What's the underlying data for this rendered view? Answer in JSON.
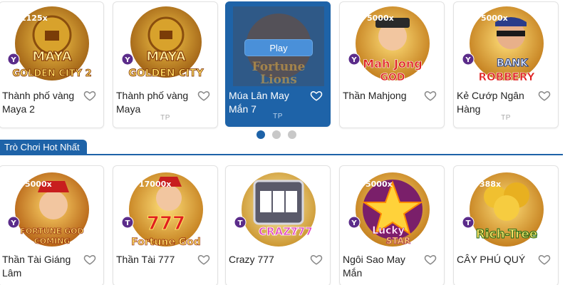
{
  "carousel_top": {
    "cards": [
      {
        "title": "Thành phố vàng Maya 2",
        "provider": "",
        "art_text": [
          "MAYA",
          "GOLDEN CITY 2"
        ],
        "multiplier": "1125x",
        "badge": "Y"
      },
      {
        "title": "Thành phố vàng Maya",
        "provider": "TP",
        "art_text": [
          "MAYA",
          "GOLDEN CITY"
        ],
        "multiplier": "",
        "badge": "Y"
      },
      {
        "title": "Múa Lân May Mắn 7",
        "provider": "TP",
        "art_text": [
          "Fortune",
          "Lions"
        ],
        "multiplier": "",
        "badge": "",
        "play_label": "Play"
      },
      {
        "title": "Thần Mahjong",
        "provider": "",
        "art_text": [
          "Mah Jong",
          "GOD"
        ],
        "multiplier": "5000x",
        "badge": "Y"
      },
      {
        "title": "Kẻ Cướp Ngân Hàng",
        "provider": "TP",
        "art_text": [
          "BANK",
          "ROBBERY"
        ],
        "multiplier": "5000x",
        "badge": "Y"
      }
    ],
    "active_dot": 0,
    "dot_count": 3
  },
  "section": {
    "title": "Trò Chơi Hot Nhất"
  },
  "carousel_bottom": {
    "cards": [
      {
        "title": "Thần Tài Giáng Lâm",
        "provider": "",
        "art_text": [
          "FORTUNE GOD",
          "COMING"
        ],
        "multiplier": "5000x",
        "badge": "Y"
      },
      {
        "title": "Thần Tài 777",
        "provider": "",
        "art_text": [
          "777",
          "Fortune God"
        ],
        "multiplier": "17000x",
        "badge": "T"
      },
      {
        "title": "Crazy 777",
        "provider": "",
        "art_text": [
          "CRAZY",
          "777"
        ],
        "multiplier": "",
        "badge": "T"
      },
      {
        "title": "Ngôi Sao May Mắn",
        "provider": "",
        "art_text": [
          "Lucky",
          "STAR"
        ],
        "multiplier": "5000x",
        "badge": "Y"
      },
      {
        "title": "CÂY PHÚ QUÝ",
        "provider": "",
        "art_text": [
          "Rich-Tree"
        ],
        "multiplier": "388x",
        "badge": "T"
      }
    ]
  },
  "colors": {
    "accent": "#1e63a8",
    "play": "#4a90d9",
    "border": "#e2e2e2"
  }
}
